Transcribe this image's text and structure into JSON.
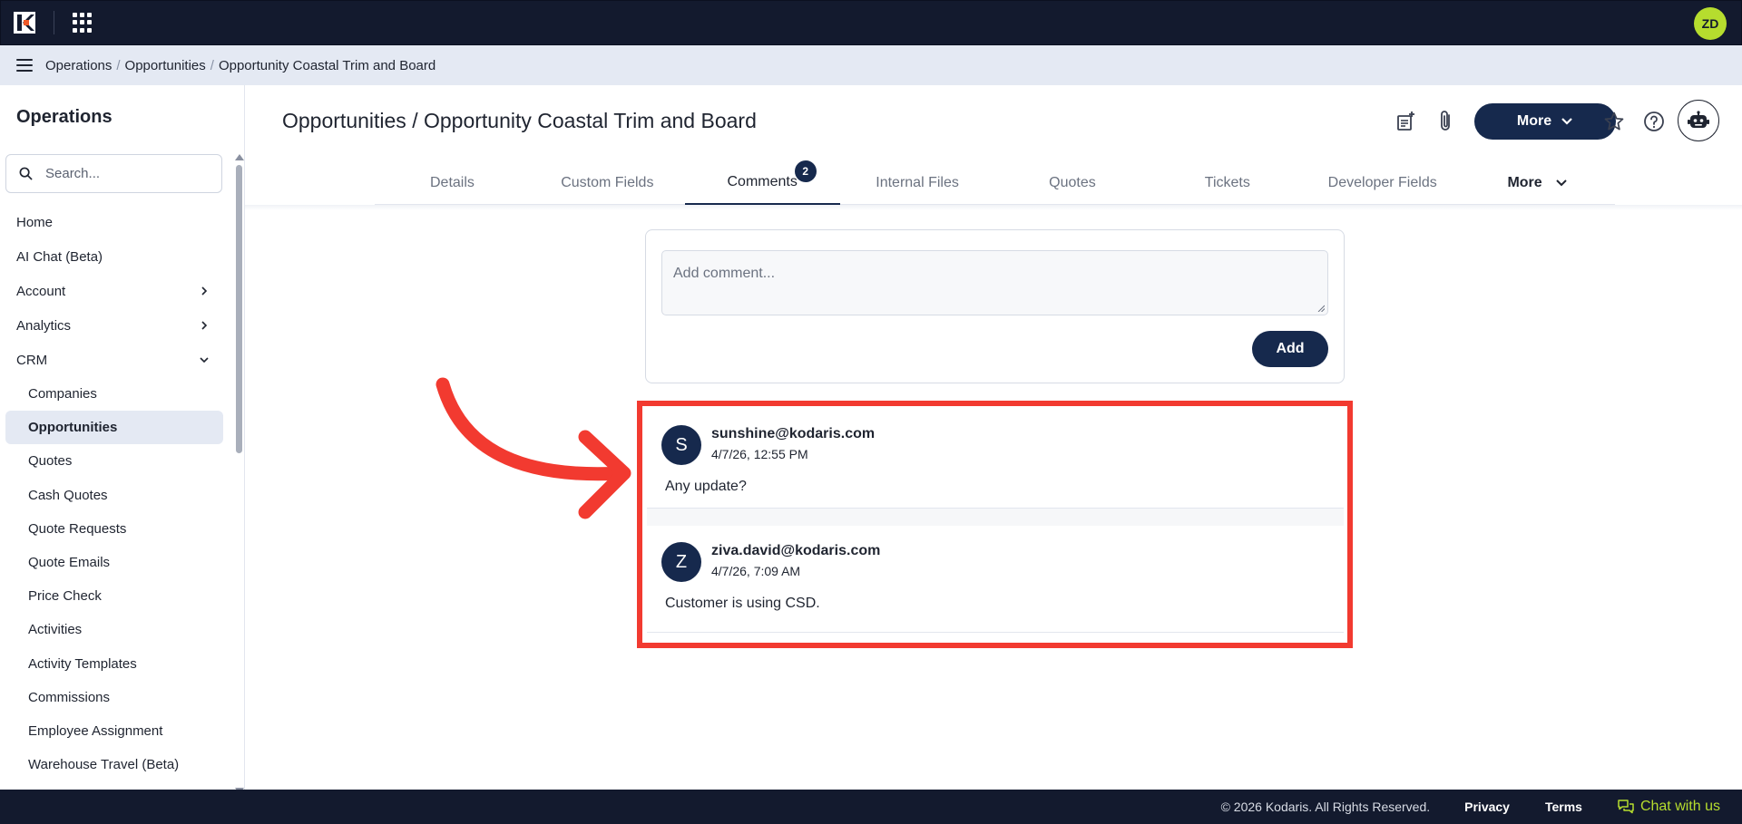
{
  "user": {
    "initials": "ZD"
  },
  "breadcrumb": {
    "items": [
      "Operations",
      "Opportunities",
      "Opportunity Coastal Trim and Board"
    ],
    "separator": "/"
  },
  "sidebar": {
    "title": "Operations",
    "search_placeholder": "Search...",
    "items": [
      {
        "label": "Home"
      },
      {
        "label": "AI Chat (Beta)"
      },
      {
        "label": "Account",
        "expandable": true
      },
      {
        "label": "Analytics",
        "expandable": true
      },
      {
        "label": "CRM",
        "expanded": true
      }
    ],
    "crm_children": [
      "Companies",
      "Opportunities",
      "Quotes",
      "Cash Quotes",
      "Quote Requests",
      "Quote Emails",
      "Price Check",
      "Activities",
      "Activity Templates",
      "Commissions",
      "Employee Assignment",
      "Warehouse Travel (Beta)"
    ],
    "active_child": "Opportunities"
  },
  "header": {
    "title": "Opportunities / Opportunity Coastal Trim and Board",
    "more_label": "More",
    "icons": [
      "note-add-icon",
      "attachment-icon",
      "star-icon",
      "help-icon",
      "bot-icon"
    ]
  },
  "tabs": {
    "items": [
      "Details",
      "Custom Fields",
      "Comments",
      "Internal Files",
      "Quotes",
      "Tickets",
      "Developer Fields"
    ],
    "active": "Comments",
    "comments_badge": "2",
    "more_label": "More"
  },
  "composer": {
    "placeholder": "Add comment...",
    "value": "",
    "add_label": "Add"
  },
  "comments": [
    {
      "initial": "S",
      "author": "sunshine@kodaris.com",
      "time": "4/7/26, 12:55 PM",
      "body": "Any update?"
    },
    {
      "initial": "Z",
      "author": "ziva.david@kodaris.com",
      "time": "4/7/26, 7:09 AM",
      "body": "Customer is using CSD."
    }
  ],
  "footer": {
    "copyright": "© 2026 Kodaris. All Rights Reserved.",
    "privacy": "Privacy",
    "terms": "Terms",
    "chat": "Chat with us"
  },
  "colors": {
    "navy": "#131a2e",
    "brand_dark": "#16294d",
    "accent_lime": "#b6dd2e",
    "highlight_red": "#f23a30"
  }
}
